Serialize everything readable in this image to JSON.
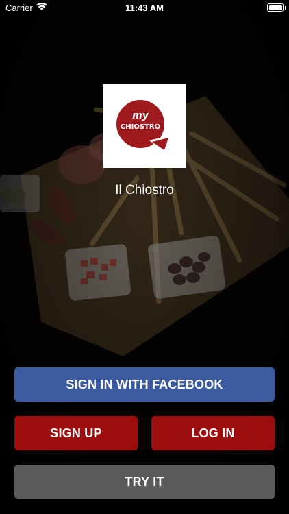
{
  "status_bar": {
    "carrier": "Carrier",
    "time": "11:43 AM",
    "wifi_icon": "wifi-icon",
    "battery_icon": "battery-icon",
    "battery_level": 1.0
  },
  "logo": {
    "line1": "my",
    "line2": "CHIOSTRO",
    "color": "#9e1a1f"
  },
  "app_name": "Il Chiostro",
  "buttons": {
    "facebook": "SIGN IN WITH FACEBOOK",
    "signup": "SIGN UP",
    "login": "LOG IN",
    "try": "TRY IT"
  },
  "colors": {
    "facebook": "#3c5aa0",
    "primary_red": "#9e0d0d",
    "try_gray": "#5b5b5b"
  }
}
